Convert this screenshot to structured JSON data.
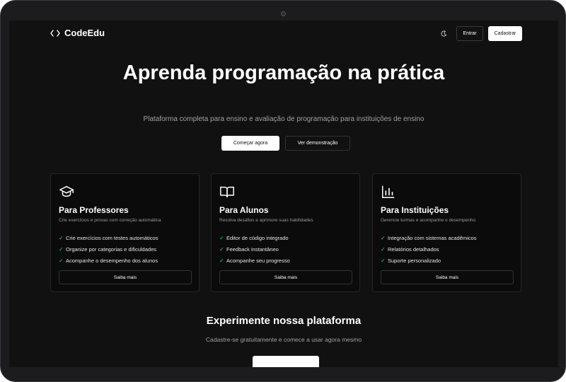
{
  "brand": {
    "name": "CodeEdu",
    "icon": "code-brackets-icon"
  },
  "nav": {
    "theme_icon": "moon-icon",
    "login_label": "Entrar",
    "signup_label": "Cadastrar"
  },
  "hero": {
    "title": "Aprenda programação na prática",
    "subtitle": "Plataforma completa para ensino e avaliação de programação para instituições de ensino",
    "primary_label": "Começar agora",
    "secondary_label": "Ver demonstração"
  },
  "cards": [
    {
      "icon": "graduation-cap-icon",
      "title": "Para Professores",
      "desc": "Crie exercícios e provas com correção automática",
      "features": [
        "Crie exercícios com testes automáticos",
        "Organize por categorias e dificuldades",
        "Acompanhe o desempenho dos alunos"
      ],
      "button": "Saiba mais"
    },
    {
      "icon": "open-book-icon",
      "title": "Para Alunos",
      "desc": "Resolva desafios e aprimore suas habilidades",
      "features": [
        "Editor de código integrado",
        "Feedback instantâneo",
        "Acompanhe seu progresso"
      ],
      "button": "Saiba mais"
    },
    {
      "icon": "bar-chart-icon",
      "title": "Para Instituições",
      "desc": "Gerencie turmas e acompanhe o desempenho",
      "features": [
        "Integração com sistemas acadêmicos",
        "Relatórios detalhados",
        "Suporte personalizado"
      ],
      "button": "Saiba mais"
    }
  ],
  "try_section": {
    "title": "Experimente nossa plataforma",
    "subtitle": "Cadastre-se gratuitamente e comece a usar agora mesmo"
  },
  "colors": {
    "background": "#111111",
    "card": "#0b0b0b",
    "check": "#2ecc71",
    "text": "#ffffff",
    "muted": "#a1a1a6"
  }
}
